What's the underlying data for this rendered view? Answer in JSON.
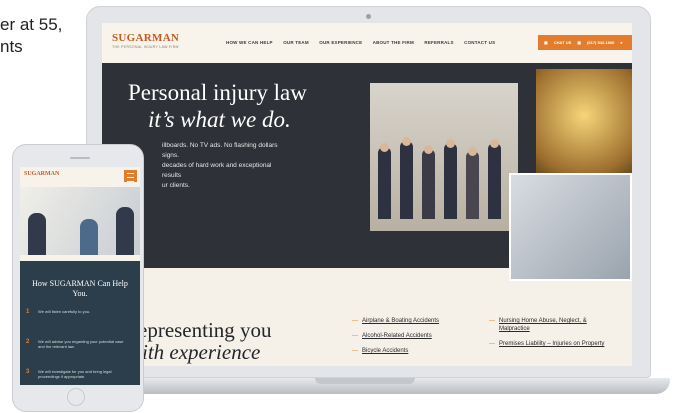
{
  "intro": {
    "line1": "er at 55,",
    "line2": "nts"
  },
  "site": {
    "logo": "SUGARMAN",
    "tagline": "THE PERSONAL INJURY LAW FIRM",
    "nav": [
      "HOW WE CAN HELP",
      "OUR TEAM",
      "OUR EXPERIENCE",
      "ABOUT THE FIRM",
      "REFERRALS",
      "CONTACT US"
    ],
    "cta": {
      "chat": "CHAT US",
      "phone": "(617) 542-1000"
    }
  },
  "hero": {
    "title_line1": "Personal injury law",
    "title_line2": "it’s what we do.",
    "sub_line1": "illboards. No TV ads. No flashing dollars signs.",
    "sub_line2": "decades of hard work and exceptional results",
    "sub_line3": "ur clients."
  },
  "rep": {
    "line1": "epresenting you",
    "line2": "ith experience"
  },
  "practice_col1": [
    "Airplane & Boating Accidents",
    "Alcohol-Related Accidents",
    "Bicycle Accidents"
  ],
  "practice_col2": [
    "Nursing Home Abuse, Neglect, & Malpractice",
    "Premises Liability – Injuries on Property"
  ],
  "mobile": {
    "logo": "SUGARMAN",
    "section_title": "How SUGARMAN Can Help You.",
    "steps": [
      {
        "num": "1",
        "text": "We will listen carefully to you."
      },
      {
        "num": "2",
        "text": "We will advise you regarding your potential case and the relevant law."
      },
      {
        "num": "3",
        "text": "We will investigate for you and bring legal proceedings if appropriate."
      }
    ]
  },
  "colors": {
    "accent": "#e37d2d",
    "logo": "#c65a1e",
    "hero_bg": "#2f3138",
    "mobile_dark": "#2c3e4b"
  }
}
